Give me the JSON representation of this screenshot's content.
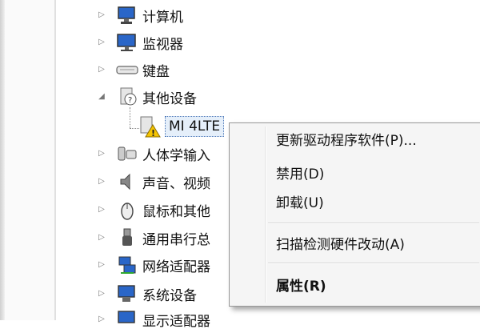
{
  "tree": {
    "items": [
      {
        "label": "计算机",
        "icon": "computer-icon",
        "expanded": false
      },
      {
        "label": "监视器",
        "icon": "monitor-icon",
        "expanded": false
      },
      {
        "label": "键盘",
        "icon": "keyboard-icon",
        "expanded": false
      },
      {
        "label": "其他设备",
        "icon": "unknown-device-icon",
        "expanded": true
      },
      {
        "label": "MI 4LTE",
        "icon": "warning-device-icon",
        "child": true
      },
      {
        "label": "人体学输入",
        "icon": "hid-icon",
        "expanded": false
      },
      {
        "label": "声音、视频",
        "icon": "speaker-icon",
        "expanded": false
      },
      {
        "label": "鼠标和其他",
        "icon": "mouse-icon",
        "expanded": false
      },
      {
        "label": "通用串行总",
        "icon": "usb-icon",
        "expanded": false
      },
      {
        "label": "网络适配器",
        "icon": "network-adapter-icon",
        "expanded": false
      },
      {
        "label": "系统设备",
        "icon": "system-device-icon",
        "expanded": false
      },
      {
        "label": "显示适配器",
        "icon": "display-adapter-icon",
        "expanded": false
      }
    ]
  },
  "context_menu": {
    "items": [
      {
        "label": "更新驱动程序软件(P)...",
        "bold": false
      },
      {
        "label": "禁用(D)",
        "bold": false
      },
      {
        "label": "卸载(U)",
        "bold": false
      },
      {
        "label": "扫描检测硬件改动(A)",
        "bold": false
      },
      {
        "label": "属性(R)",
        "bold": true
      }
    ]
  },
  "colors": {
    "selection": "#e5effa",
    "menu_background": "#f5f5f5",
    "warning": "#f5c400"
  }
}
